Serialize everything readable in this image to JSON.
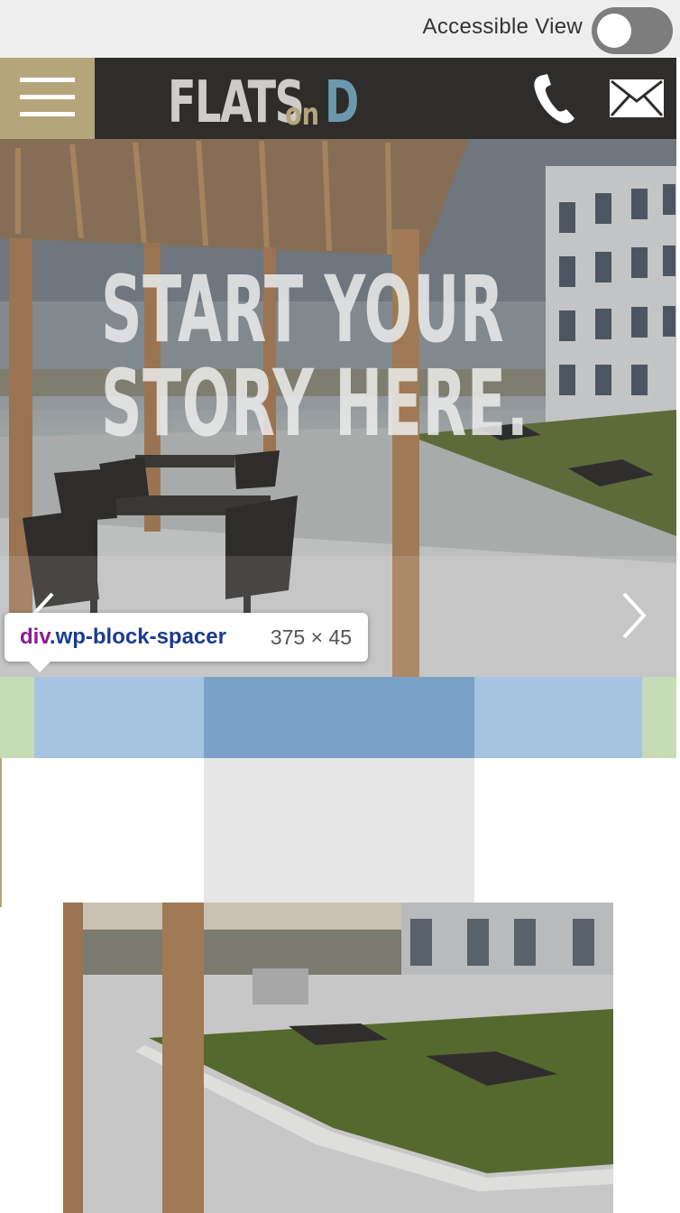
{
  "accessibility": {
    "label": "Accessible View",
    "enabled": false
  },
  "header": {
    "logo": {
      "part1": "FLATS",
      "part2": "on",
      "part3": "D"
    }
  },
  "hero": {
    "title_line1": "START YOUR",
    "title_line2": "STORY HERE."
  },
  "devtools": {
    "tag": "div",
    "class": ".wp-block-spacer",
    "size": "375 × 45"
  },
  "colors": {
    "header_bg": "#2f2d2b",
    "accent_gold": "#b5a57b",
    "accent_blue": "#6c98ad",
    "margin_green": "#c6dcb6",
    "padding_blue": "#a4c4e2",
    "content_blue": "#7ba1c9"
  },
  "icons": [
    "menu-icon",
    "phone-icon",
    "mail-icon",
    "chevron-left-icon",
    "chevron-right-icon"
  ]
}
